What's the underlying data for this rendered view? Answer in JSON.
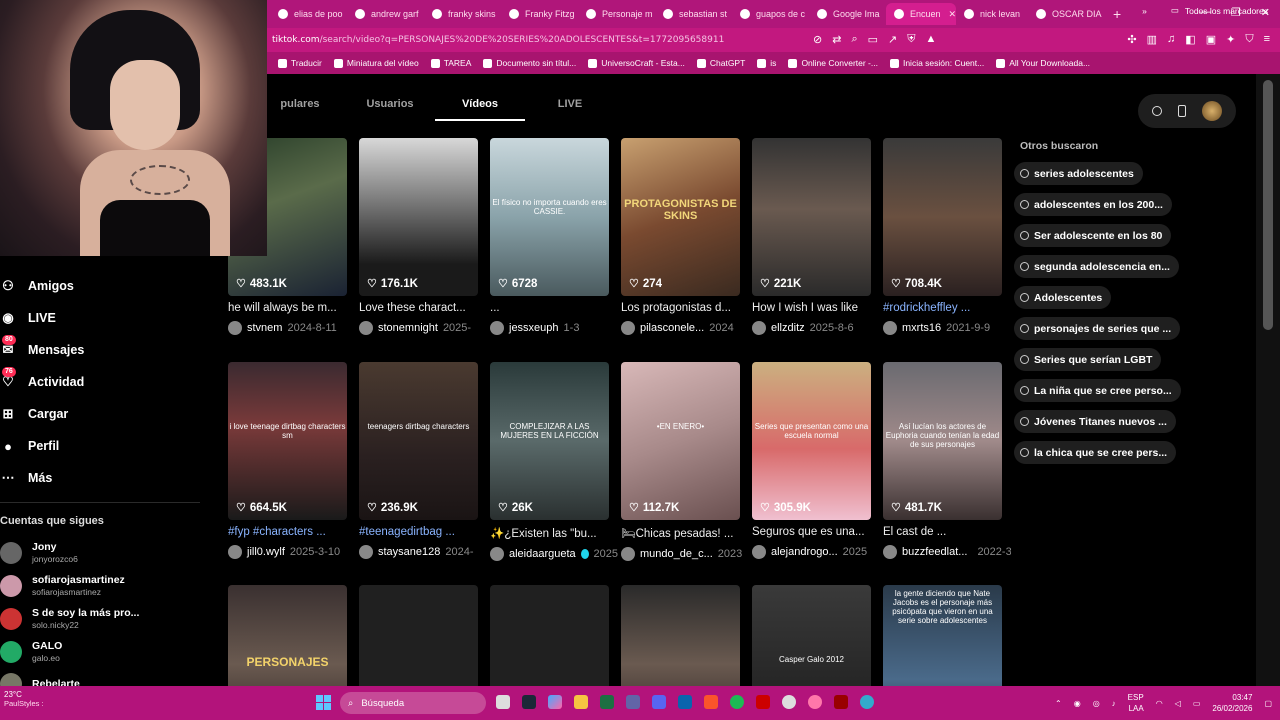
{
  "browser": {
    "tabs": [
      {
        "label": "elias de poo",
        "active": false
      },
      {
        "label": "andrew garf",
        "active": false
      },
      {
        "label": "franky skins",
        "active": false
      },
      {
        "label": "Franky Fitzg",
        "active": false
      },
      {
        "label": "Personaje m",
        "active": false
      },
      {
        "label": "sebastian st",
        "active": false
      },
      {
        "label": "guapos de c",
        "active": false
      },
      {
        "label": "Google Ima",
        "active": false
      },
      {
        "label": "Encuen",
        "active": true
      },
      {
        "label": "nick levan",
        "active": false
      },
      {
        "label": "OSCAR DIA",
        "active": false
      }
    ],
    "url_host": "tiktok.com",
    "url_path": "/search/video?q=PERSONAJES%20DE%20SERIES%20ADOLESCENTES&t=1772095658911",
    "bookmarks": [
      "Traducir",
      "Miniatura del vídeo",
      "TAREA",
      "Documento sin títul...",
      "UniversoCraft - Esta...",
      "ChatGPT",
      "is",
      "Online Converter -...",
      "Inicia sesión: Cuent...",
      "All Your Downloada..."
    ],
    "bookmarks_all": "Todos los marcadores",
    "new_tab": "+"
  },
  "search_tabs": [
    {
      "label": "pulares",
      "active": false
    },
    {
      "label": "Usuarios",
      "active": false
    },
    {
      "label": "Vídeos",
      "active": true
    },
    {
      "label": "LIVE",
      "active": false
    }
  ],
  "sidebar": {
    "nav": [
      {
        "label": "Amigos",
        "icon": "friends-icon",
        "badge": ""
      },
      {
        "label": "LIVE",
        "icon": "live-icon",
        "badge": ""
      },
      {
        "label": "Mensajes",
        "icon": "messages-icon",
        "badge": "80"
      },
      {
        "label": "Actividad",
        "icon": "activity-icon",
        "badge": "76"
      },
      {
        "label": "Cargar",
        "icon": "upload-icon",
        "badge": ""
      },
      {
        "label": "Perfil",
        "icon": "profile-icon",
        "badge": ""
      },
      {
        "label": "Más",
        "icon": "more-icon",
        "badge": ""
      }
    ],
    "following_title": "Cuentas que sigues",
    "following": [
      {
        "name": "Jony",
        "user": "jonyorozco6"
      },
      {
        "name": "sofiarojasmartinez",
        "user": "sofiarojasmartinez"
      },
      {
        "name": "S de soy la más pro...",
        "user": "solo.nicky22"
      },
      {
        "name": "GALO",
        "user": "galo.eo"
      },
      {
        "name": "Rebelarte",
        "user": ""
      }
    ]
  },
  "videos": [
    {
      "likes": "483.1K",
      "title": "he will always be m...",
      "tag": false,
      "user": "stvnem",
      "date": "2024-8-11",
      "verified": false,
      "overlay": "",
      "bg": "linear-gradient(160deg,#2a3f2a,#5a6b4a 40%,#1a2233)"
    },
    {
      "likes": "176.1K",
      "title": "Love these charact...",
      "tag": false,
      "user": "stonemnight",
      "date": "2025-",
      "verified": false,
      "overlay": "",
      "bg": "linear-gradient(180deg,#d8d8d8,#7a7a7a 40%,#1a1a1a 80%)"
    },
    {
      "likes": "6728",
      "title": "...",
      "tag": false,
      "user": "jessxeuph",
      "date": "1-3",
      "verified": false,
      "overlay": "El físico no importa cuando eres CASSIE.",
      "bg": "linear-gradient(180deg,#c9d7dc,#8aa3aa 50%,#4a5a5e)"
    },
    {
      "likes": "274",
      "title": "Los protagonistas d...",
      "tag": false,
      "user": "pilasconele...",
      "date": "2024",
      "verified": false,
      "overlay": "PROTAGONISTAS DE SKINS",
      "bg": "linear-gradient(160deg,#c8a070,#7a4a30 50%,#3a2a20)"
    },
    {
      "likes": "221K",
      "title": "How I wish I was like",
      "tag": false,
      "user": "ellzditz",
      "date": "2025-8-6",
      "verified": false,
      "overlay": "",
      "bg": "linear-gradient(180deg,#333,#6a5a50 45%,#2a2a2a)"
    },
    {
      "likes": "708.4K",
      "title": "#rodrickheffley ...",
      "tag": true,
      "user": "mxrts16",
      "date": "2021-9-9",
      "verified": false,
      "overlay": "",
      "bg": "linear-gradient(180deg,#3a3a3a,#6a5040 50%,#2a2020)"
    },
    {
      "likes": "664.5K",
      "title": "#fyp #characters ...",
      "tag": true,
      "user": "jill0.wylf",
      "date": "2025-3-10",
      "verified": false,
      "overlay": "i love teenage dirtbag characters sm",
      "bg": "linear-gradient(180deg,#3a2a30,#7a3a3a 40%,#1a1a1a)"
    },
    {
      "likes": "236.9K",
      "title": "#teenagedirtbag ...",
      "tag": true,
      "user": "staysane128",
      "date": "2024-",
      "verified": false,
      "overlay": "teenagers dirtbag characters",
      "bg": "linear-gradient(180deg,#4a3a30,#2a2020 60%,#1a1414)"
    },
    {
      "likes": "26K",
      "title": "✨¿Existen las \"bu...",
      "tag": false,
      "user": "aleidaargueta",
      "date": "2025",
      "verified": true,
      "overlay": "COMPLEJIZAR A LAS MUJERES EN LA FICCIÓN",
      "bg": "linear-gradient(180deg,#2a3a3a,#5a6a6a 50%,#2a3030)"
    },
    {
      "likes": "112.7K",
      "title": "🛏Chicas pesadas! ...",
      "tag": false,
      "user": "mundo_de_c...",
      "date": "2023",
      "verified": false,
      "overlay": "•EN ENERO•",
      "bg": "linear-gradient(160deg,#d8b8b8,#a88a8a 50%,#6a5050)"
    },
    {
      "likes": "305.9K",
      "title": "Seguros que es una...",
      "tag": false,
      "user": "alejandrogo...",
      "date": "2025",
      "verified": false,
      "overlay": "Series que presentan como una escuela normal",
      "bg": "linear-gradient(180deg,#cbb080,#d86a6a 55%,#f0c0d0)"
    },
    {
      "likes": "481.7K",
      "title": "El cast de ...",
      "tag": false,
      "user": "buzzfeedlat...",
      "date": "2022-3-4",
      "verified": true,
      "overlay": "Así lucían los actores de Euphoria cuando tenían la edad de sus personajes",
      "bg": "linear-gradient(180deg,#6a6a70,#a08a8a 50%,#3a3030)"
    },
    {
      "likes": "",
      "title": "",
      "tag": false,
      "user": "",
      "date": "",
      "verified": false,
      "overlay": "PERSONAJES",
      "bg": "linear-gradient(180deg,#3a3030,#6a5a50 50%,#2a2020)"
    },
    {
      "likes": "",
      "title": "",
      "tag": false,
      "user": "",
      "date": "",
      "verified": false,
      "overlay": "",
      "bg": "#202020"
    },
    {
      "likes": "",
      "title": "",
      "tag": false,
      "user": "",
      "date": "",
      "verified": false,
      "overlay": "",
      "bg": "#202020"
    },
    {
      "likes": "",
      "title": "",
      "tag": false,
      "user": "",
      "date": "",
      "verified": false,
      "overlay": "",
      "bg": "linear-gradient(180deg,#2a2a2a,#6a5a50 50%,#2a2020)"
    },
    {
      "likes": "",
      "title": "",
      "tag": false,
      "user": "",
      "date": "",
      "verified": false,
      "overlay": "Casper Galo 2012",
      "bg": "linear-gradient(180deg,#3a3a3a,#1a1a1a)"
    },
    {
      "likes": "",
      "title": "",
      "tag": false,
      "user": "",
      "date": "",
      "verified": false,
      "overlay": "la gente diciendo que Nate Jacobs es el personaje más psicópata que vieron en una serie sobre adolescentes",
      "bg": "linear-gradient(180deg,#2a3a4a,#4a6a8a 60%,#1a2a3a)"
    }
  ],
  "related": {
    "title": "Otros buscaron",
    "items": [
      "series adolescentes",
      "adolescentes en los 200...",
      "Ser adolescente en los 80",
      "segunda adolescencia en...",
      "Adolescentes",
      "personajes de series que ...",
      "Series que serían LGBT",
      "La niña que se cree perso...",
      "Jóvenes Titanes nuevos ...",
      "la chica que se cree pers..."
    ]
  },
  "taskbar": {
    "weather_temp": "23°C",
    "weather_app": "PaulStyles :",
    "search_placeholder": "Búsqueda",
    "lang": "ESP",
    "lang2": "LAA",
    "time": "03:47",
    "date": "26/02/2026"
  }
}
